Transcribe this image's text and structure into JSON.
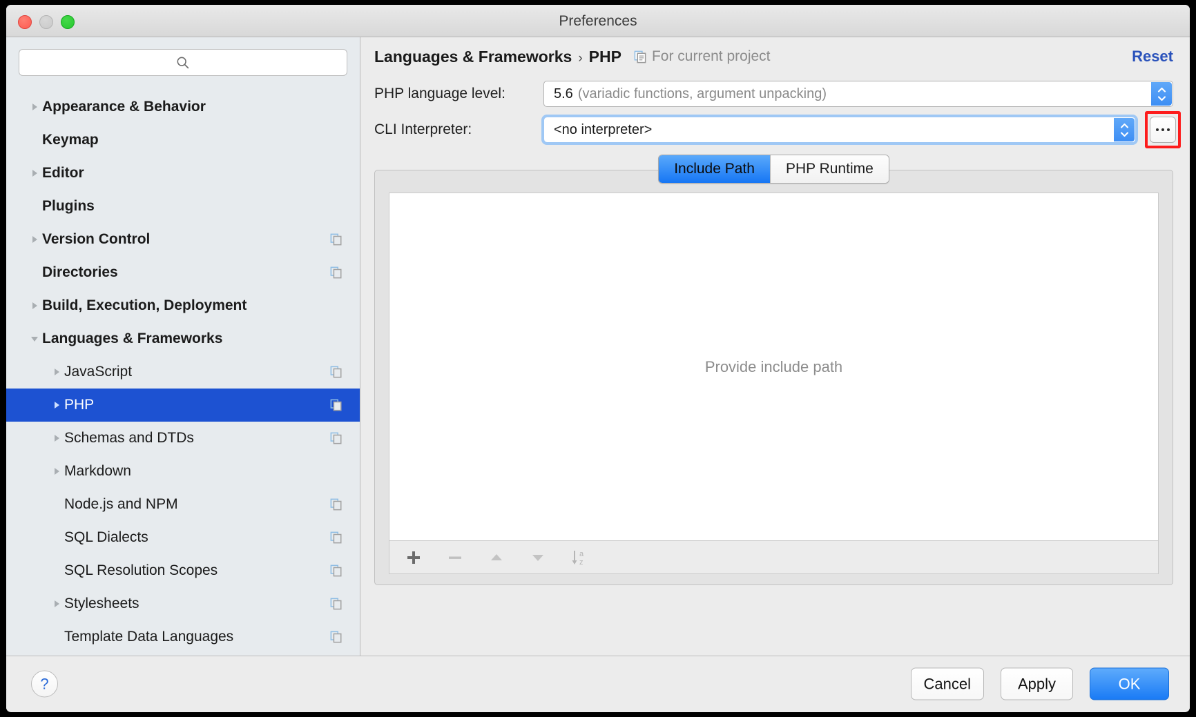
{
  "window": {
    "title": "Preferences",
    "traffic_lights": [
      "close",
      "minimize",
      "zoom"
    ]
  },
  "search": {
    "value": "",
    "placeholder": "",
    "icon": "search-icon"
  },
  "sidebar": {
    "items": [
      {
        "label": "Appearance & Behavior",
        "level": "top",
        "twisty": "collapsed",
        "scope_icon": false,
        "selected": false
      },
      {
        "label": "Keymap",
        "level": "top",
        "twisty": "none",
        "scope_icon": false,
        "selected": false
      },
      {
        "label": "Editor",
        "level": "top",
        "twisty": "collapsed",
        "scope_icon": false,
        "selected": false
      },
      {
        "label": "Plugins",
        "level": "top",
        "twisty": "none",
        "scope_icon": false,
        "selected": false
      },
      {
        "label": "Version Control",
        "level": "top",
        "twisty": "collapsed",
        "scope_icon": true,
        "selected": false
      },
      {
        "label": "Directories",
        "level": "top",
        "twisty": "none",
        "scope_icon": true,
        "selected": false
      },
      {
        "label": "Build, Execution, Deployment",
        "level": "top",
        "twisty": "collapsed",
        "scope_icon": false,
        "selected": false
      },
      {
        "label": "Languages & Frameworks",
        "level": "top",
        "twisty": "expanded",
        "scope_icon": false,
        "selected": false
      },
      {
        "label": "JavaScript",
        "level": "child",
        "twisty": "collapsed",
        "scope_icon": true,
        "selected": false
      },
      {
        "label": "PHP",
        "level": "child",
        "twisty": "collapsed",
        "scope_icon": true,
        "selected": true
      },
      {
        "label": "Schemas and DTDs",
        "level": "child",
        "twisty": "collapsed",
        "scope_icon": true,
        "selected": false
      },
      {
        "label": "Markdown",
        "level": "child",
        "twisty": "collapsed",
        "scope_icon": false,
        "selected": false
      },
      {
        "label": "Node.js and NPM",
        "level": "child",
        "twisty": "none",
        "scope_icon": true,
        "selected": false
      },
      {
        "label": "SQL Dialects",
        "level": "child",
        "twisty": "none",
        "scope_icon": true,
        "selected": false
      },
      {
        "label": "SQL Resolution Scopes",
        "level": "child",
        "twisty": "none",
        "scope_icon": true,
        "selected": false
      },
      {
        "label": "Stylesheets",
        "level": "child",
        "twisty": "collapsed",
        "scope_icon": true,
        "selected": false
      },
      {
        "label": "Template Data Languages",
        "level": "child",
        "twisty": "none",
        "scope_icon": true,
        "selected": false
      }
    ]
  },
  "main": {
    "breadcrumb": {
      "parent": "Languages & Frameworks",
      "separator": "›",
      "current": "PHP"
    },
    "scope_note": "For current project",
    "reset_label": "Reset",
    "fields": {
      "language_level": {
        "label": "PHP language level:",
        "value_bold": "5.6",
        "value_dim": "(variadic functions, argument unpacking)"
      },
      "cli_interpreter": {
        "label": "CLI Interpreter:",
        "value": "<no interpreter>",
        "browse_label": "..."
      }
    },
    "tabs": [
      {
        "label": "Include Path",
        "active": true
      },
      {
        "label": "PHP Runtime",
        "active": false
      }
    ],
    "list": {
      "empty_text": "Provide include path",
      "items": [],
      "toolbar": [
        {
          "name": "add-button",
          "glyph": "plus"
        },
        {
          "name": "remove-button",
          "glyph": "minus"
        },
        {
          "name": "move-up-button",
          "glyph": "up"
        },
        {
          "name": "move-down-button",
          "glyph": "down"
        },
        {
          "name": "sort-alphabetically-button",
          "glyph": "sort-az"
        }
      ]
    }
  },
  "footer": {
    "help_label": "?",
    "buttons": [
      {
        "label": "Cancel",
        "kind": "secondary"
      },
      {
        "label": "Apply",
        "kind": "secondary"
      },
      {
        "label": "OK",
        "kind": "primary"
      }
    ]
  },
  "colors": {
    "selection_blue": "#1d52d2",
    "accent_blue": "#1a7bf5",
    "link_blue": "#2a52bb",
    "highlight_red": "#fd1c1c",
    "sidebar_bg": "#e7ebee",
    "panel_bg": "#ececec"
  }
}
